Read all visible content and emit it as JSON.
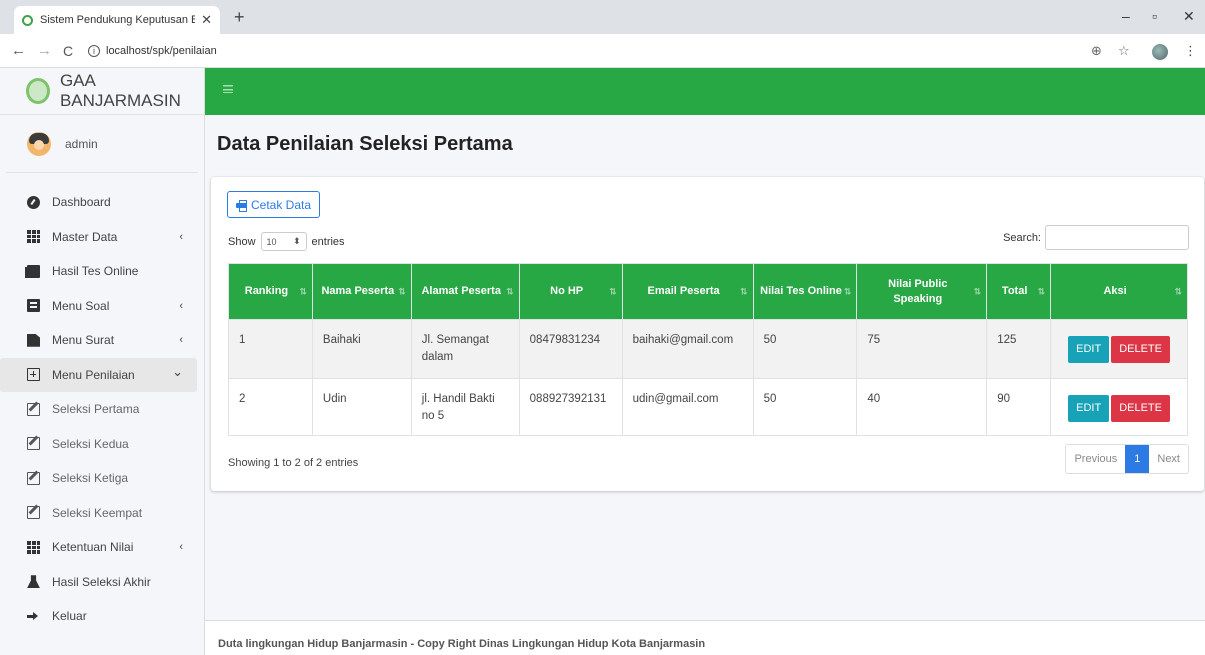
{
  "browser": {
    "tab_title": "Sistem Pendukung Keputusan Be",
    "tab_close": "✕",
    "new_tab": "+",
    "url": "localhost/spk/penilaian",
    "back": "←",
    "forward": "→",
    "reload": "C",
    "zoom_icon": "⊕",
    "star_icon": "☆",
    "menu_icon": "⋮",
    "min": "–",
    "max": "▫",
    "close": "✕"
  },
  "sidebar": {
    "brand": "GAA BANJARMASIN",
    "user": "admin",
    "items": [
      {
        "label": "Dashboard",
        "icon": "dashboard-icon",
        "chevron": ""
      },
      {
        "label": "Master Data",
        "icon": "grid-icon",
        "chevron": "‹"
      },
      {
        "label": "Hasil Tes Online",
        "icon": "cards-icon",
        "chevron": ""
      },
      {
        "label": "Menu Soal",
        "icon": "book-icon",
        "chevron": "‹"
      },
      {
        "label": "Menu Surat",
        "icon": "file-icon",
        "chevron": "‹"
      },
      {
        "label": "Menu Penilaian",
        "icon": "plus-square-icon",
        "chevron": "⌄"
      },
      {
        "label": "Seleksi Pertama",
        "icon": "edit-icon",
        "chevron": ""
      },
      {
        "label": "Seleksi Kedua",
        "icon": "edit-icon",
        "chevron": ""
      },
      {
        "label": "Seleksi Ketiga",
        "icon": "edit-icon",
        "chevron": ""
      },
      {
        "label": "Seleksi Keempat",
        "icon": "edit-icon",
        "chevron": ""
      },
      {
        "label": "Ketentuan Nilai",
        "icon": "grid-icon",
        "chevron": "‹"
      },
      {
        "label": "Hasil Seleksi Akhir",
        "icon": "flask-icon",
        "chevron": ""
      },
      {
        "label": "Keluar",
        "icon": "sign-out-icon",
        "chevron": ""
      }
    ]
  },
  "main": {
    "title": "Data Penilaian Seleksi Pertama",
    "print_label": "Cetak Data",
    "show_label": "Show",
    "entries_label": "entries",
    "page_length": "10",
    "search_label": "Search:",
    "search_value": "",
    "sort_glyph": "⇅",
    "columns": [
      "Ranking",
      "Nama Peserta",
      "Alamat Peserta",
      "No HP",
      "Email Peserta",
      "Nilai Tes Online",
      "Nilai Public Speaking",
      "Total",
      "Aksi"
    ],
    "rows": [
      {
        "rank": "1",
        "nama": "Baihaki",
        "alamat": "Jl. Semangat dalam",
        "hp": "08479831234",
        "email": "baihaki@gmail.com",
        "tes": "50",
        "ps": "75",
        "total": "125"
      },
      {
        "rank": "2",
        "nama": "Udin",
        "alamat": "jl. Handil Bakti no 5",
        "hp": "088927392131",
        "email": "udin@gmail.com",
        "tes": "50",
        "ps": "40",
        "total": "90"
      }
    ],
    "edit_label": "EDIT",
    "delete_label": "DELETE",
    "info": "Showing 1 to 2 of 2 entries",
    "pager": {
      "prev": "Previous",
      "current": "1",
      "next": "Next"
    }
  },
  "footer": "Duta lingkungan Hidup Banjarmasin - Copy Right Dinas Lingkungan Hidup Kota Banjarmasin",
  "colors": {
    "accent_green": "#28a745",
    "edit": "#17a2b8",
    "delete": "#dc3545",
    "primary": "#2c7be5"
  }
}
